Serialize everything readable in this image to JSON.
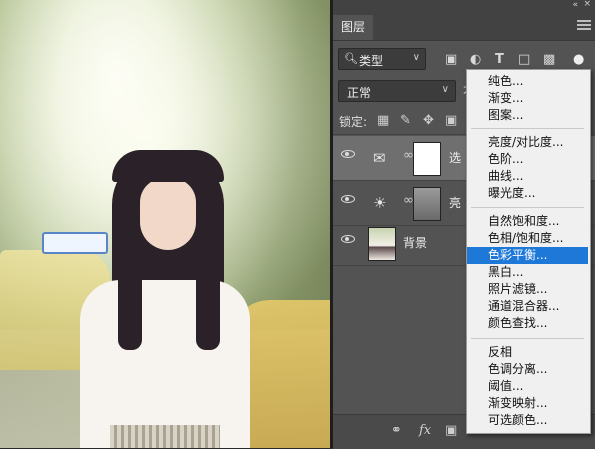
{
  "panel": {
    "tab_label": "图层",
    "collapse_glyph": "«",
    "close_glyph": "×",
    "filter": {
      "kind_label": "类型",
      "kind_icon": "magnifier-icon",
      "dropdown_glyph": "∨"
    },
    "filter_icons": [
      "image-filter-icon",
      "adjustment-filter-icon",
      "type-filter-icon",
      "shape-filter-icon",
      "smart-object-filter-icon"
    ],
    "blend_mode": "正常",
    "blend_dropdown_glyph": "∨",
    "opacity_initial": "不",
    "lock_label": "锁定:",
    "lock_icons": [
      "lock-transparent-icon",
      "lock-brush-icon",
      "lock-move-icon",
      "lock-artboard-icon"
    ],
    "layers": [
      {
        "name": "选",
        "type": "color-balance",
        "icon": "color-balance-icon",
        "mask": "white",
        "selected": true
      },
      {
        "name": "亮",
        "type": "brightness",
        "icon": "brightness-icon",
        "mask": "grey",
        "selected": false
      },
      {
        "name": "背景",
        "type": "image",
        "selected": false
      }
    ],
    "bottom_icons": [
      "link-layers-icon",
      "fx-icon",
      "add-mask-icon"
    ],
    "fx_label": "fx"
  },
  "menu": {
    "groups": [
      [
        "纯色...",
        "渐变...",
        "图案..."
      ],
      [
        "亮度/对比度...",
        "色阶...",
        "曲线...",
        "曝光度..."
      ],
      [
        "自然饱和度...",
        "色相/饱和度...",
        "色彩平衡...",
        "黑白...",
        "照片滤镜...",
        "通道混合器...",
        "颜色查找..."
      ],
      [
        "反相",
        "色调分离...",
        "阈值...",
        "渐变映射...",
        "可选颜色..."
      ]
    ],
    "highlighted": "色彩平衡...",
    "highlight_color": "#1e78d7"
  },
  "colors": {
    "panel_bg": "#535353",
    "selected_layer_bg": "#6f6f6f",
    "menu_bg": "#f0f0f0"
  }
}
